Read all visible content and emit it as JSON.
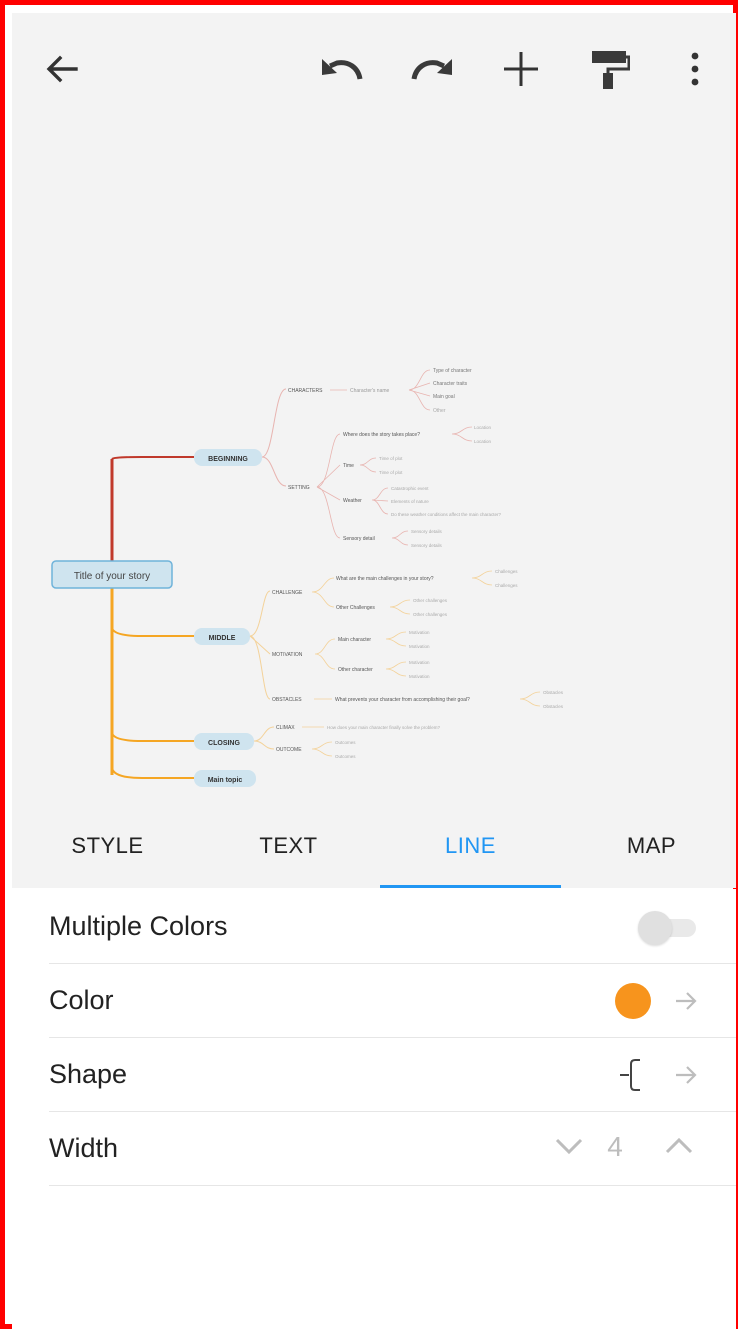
{
  "toolbar": {
    "back": "arrow-left-icon",
    "undo": "undo-icon",
    "redo": "redo-icon",
    "add": "plus-icon",
    "format": "paint-roller-icon",
    "more": "more-vert-icon"
  },
  "mindmap": {
    "central": "Title of your story",
    "topics": {
      "beginning": "BEGINNING",
      "middle": "MIDDLE",
      "closing": "CLOSING",
      "main": "Main topic"
    },
    "beginning": {
      "characters": "CHARACTERS",
      "characters_sub": "Character's name",
      "characters_leaves": [
        "Type of character",
        "Character traits",
        "Main goal",
        "Other"
      ],
      "setting": "SETTING",
      "setting_items": [
        "Where does the story takes place?",
        "Time",
        "Weather",
        "Sensory detail"
      ],
      "setting_where_leaves": [
        "Location",
        "Location"
      ],
      "setting_time_leaves": [
        "Time of plot",
        "Time of plot"
      ],
      "setting_weather_leaves": [
        "Catastrophic event",
        "Elements of nature",
        "Do these weather conditions affect the main character?"
      ],
      "setting_sensory_leaves": [
        "Sensory details",
        "Sensory details"
      ]
    },
    "middle": {
      "challenge": "CHALLENGE",
      "challenge_items": [
        "What are the main challenges in your story?",
        "Other Challenges"
      ],
      "challenge_main_leaves": [
        "Challenges",
        "Challenges"
      ],
      "challenge_other_leaves": [
        "Other challenges",
        "Other challenges"
      ],
      "motivation": "MOTIVATION",
      "motivation_items": [
        "Main character",
        "Other character"
      ],
      "motivation_main_leaves": [
        "Motivation",
        "Motivation"
      ],
      "motivation_other_leaves": [
        "Motivation",
        "Motivation"
      ],
      "obstacles": "OBSTACLES",
      "obstacles_item": "What prevents your character from accomplishing their goal?",
      "obstacles_leaves": [
        "Obstacles",
        "Obstacles"
      ]
    },
    "closing": {
      "climax": "CLIMAX",
      "climax_item": "How does your main character finally solve the problem?",
      "outcome": "OUTCOME",
      "outcome_leaves": [
        "Outcomes",
        "Outcomes"
      ]
    }
  },
  "tabs": [
    "STYLE",
    "TEXT",
    "LINE",
    "MAP"
  ],
  "active_tab": "LINE",
  "panel": {
    "multiple_colors": {
      "label": "Multiple Colors",
      "enabled": false
    },
    "color": {
      "label": "Color",
      "value": "#f7941d"
    },
    "shape": {
      "label": "Shape"
    },
    "width": {
      "label": "Width",
      "value": "4"
    }
  },
  "colors": {
    "accent": "#2196f3",
    "branch_red": "#c0392b",
    "branch_orange": "#f5a623",
    "topic_fill": "#cfe4ef"
  }
}
